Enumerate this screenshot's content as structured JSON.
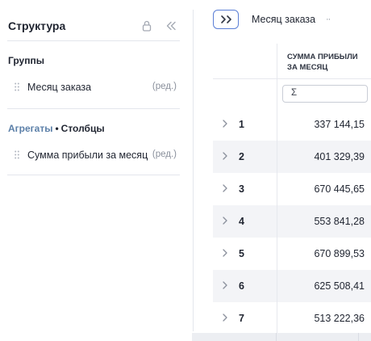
{
  "panel": {
    "title": "Структура",
    "lock_icon": "lock-icon",
    "collapse_icon": "double-chevron-left-icon"
  },
  "groups": {
    "title": "Группы",
    "items": [
      {
        "label": "Месяц заказа",
        "edit": "(ред.)"
      }
    ]
  },
  "aggregates": {
    "title_muted": "Агрегаты",
    "separator": "•",
    "title_bold": "Столбцы",
    "items": [
      {
        "label": "Сумма прибыли за месяц",
        "edit": "(ред.)"
      }
    ]
  },
  "toolbar": {
    "expand_icon": "double-chevron-right-icon",
    "pivot_label": "Месяц заказа",
    "more": "··"
  },
  "grid": {
    "column_header": "СУММА ПРИБЫЛИ ЗА МЕСЯЦ",
    "filter_value": "Σ",
    "rows": [
      {
        "key": "1",
        "value": "337 144,15"
      },
      {
        "key": "2",
        "value": "401 329,39"
      },
      {
        "key": "3",
        "value": "670 445,65"
      },
      {
        "key": "4",
        "value": "553 841,28"
      },
      {
        "key": "5",
        "value": "670 899,53"
      },
      {
        "key": "6",
        "value": "625 508,41"
      },
      {
        "key": "7",
        "value": "513 222,36"
      }
    ]
  },
  "colors": {
    "accent": "#5b7fd6",
    "muted_link": "#5b7fa8",
    "row_alt": "#f3f4f7"
  }
}
